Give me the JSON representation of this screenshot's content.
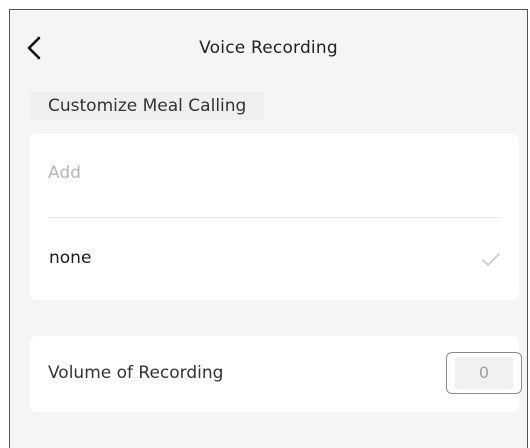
{
  "header": {
    "title": "Voice Recording"
  },
  "section": {
    "title": "Customize Meal Calling"
  },
  "meal_calling": {
    "add_placeholder": "Add",
    "add_value": "",
    "options": [
      {
        "label": "none",
        "selected": true
      }
    ]
  },
  "volume": {
    "label": "Volume of Recording",
    "value": "0"
  },
  "icons": {
    "back": "chevron-left-icon",
    "selected": "checkmark-icon"
  },
  "colors": {
    "background": "#f5f5f5",
    "card": "#ffffff",
    "placeholder": "#b5b5b5",
    "check": "#c8c8c8"
  }
}
